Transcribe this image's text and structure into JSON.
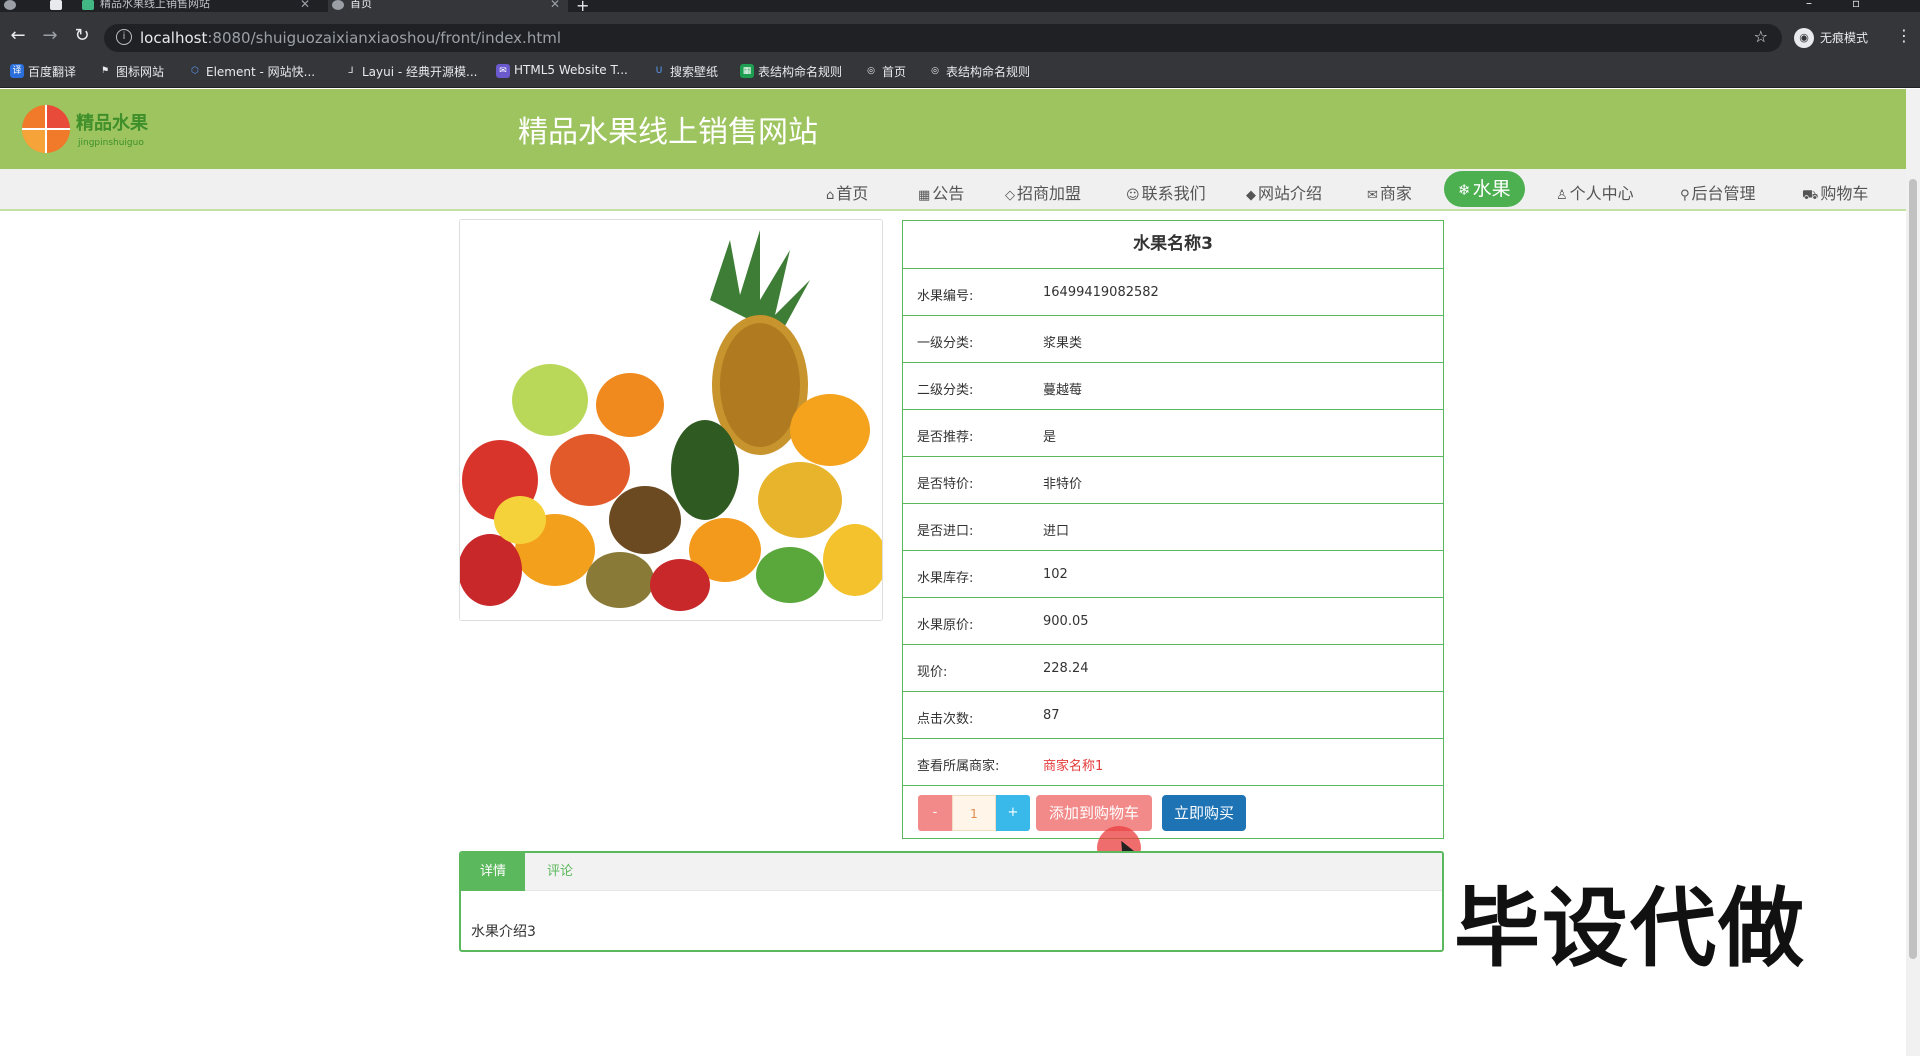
{
  "browser": {
    "tabs": [
      {
        "title": "精品水果线上销售网站"
      },
      {
        "title": "首页"
      }
    ],
    "url_host": "localhost",
    "url_rest": ":8080/shuiguozaixianxiaoshou/front/index.html",
    "incognito_label": "无痕模式",
    "bookmarks": [
      {
        "label": "百度翻译"
      },
      {
        "label": "图标网站"
      },
      {
        "label": "Element - 网站快..."
      },
      {
        "label": "Layui - 经典开源模..."
      },
      {
        "label": "HTML5 Website T..."
      },
      {
        "label": "搜索壁纸"
      },
      {
        "label": "表结构命名规则"
      },
      {
        "label": "首页"
      },
      {
        "label": "表结构命名规则"
      }
    ]
  },
  "site": {
    "title": "精品水果线上销售网站",
    "logo_text": "精品水果",
    "logo_sub": "jingpinshuiguo"
  },
  "menu": [
    {
      "icon": "⌂",
      "label": "首页"
    },
    {
      "icon": "▦",
      "label": "公告"
    },
    {
      "icon": "◇",
      "label": "招商加盟"
    },
    {
      "icon": "☺",
      "label": "联系我们"
    },
    {
      "icon": "◆",
      "label": "网站介绍"
    },
    {
      "icon": "✉",
      "label": "商家"
    },
    {
      "icon": "❄",
      "label": "水果"
    },
    {
      "icon": "♙",
      "label": "个人中心"
    },
    {
      "icon": "⚲",
      "label": "后台管理"
    },
    {
      "icon": "⛟",
      "label": "购物车"
    }
  ],
  "product": {
    "name": "水果名称3",
    "fields": [
      {
        "label": "水果编号:",
        "value": "16499419082582"
      },
      {
        "label": "一级分类:",
        "value": "浆果类"
      },
      {
        "label": "二级分类:",
        "value": "蔓越莓"
      },
      {
        "label": "是否推荐:",
        "value": "是"
      },
      {
        "label": "是否特价:",
        "value": "非特价"
      },
      {
        "label": "是否进口:",
        "value": "进口"
      },
      {
        "label": "水果库存:",
        "value": "102"
      },
      {
        "label": "水果原价:",
        "value": "900.05"
      },
      {
        "label": "现价:",
        "value": "228.24"
      },
      {
        "label": "点击次数:",
        "value": "87"
      },
      {
        "label": "查看所属商家:",
        "value": "商家名称1"
      }
    ],
    "qty_minus": "-",
    "qty": "1",
    "qty_plus": "+",
    "add_cart": "添加到购物车",
    "buy_now": "立即购买"
  },
  "detail_tabs": {
    "tab1": "详情",
    "tab2": "评论",
    "content": "水果介绍3"
  },
  "watermark": "毕设代做",
  "colors": {
    "header": "#9dc45f",
    "accent": "#5cb85c",
    "active_menu": "#4caf50",
    "add_cart": "#f28a8a",
    "buy_now": "#1e73b5",
    "shop_link": "#e43a3a"
  }
}
